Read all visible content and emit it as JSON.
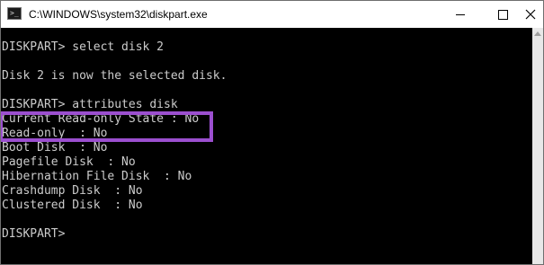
{
  "window": {
    "title": "C:\\WINDOWS\\system32\\diskpart.exe",
    "icon": "console-app-icon"
  },
  "controls": {
    "minimize": "minimize-icon",
    "maximize": "maximize-icon",
    "close": "close-icon"
  },
  "console": {
    "lines": [
      "DISKPART> select disk 2",
      "",
      "Disk 2 is now the selected disk.",
      "",
      "DISKPART> attributes disk",
      "Current Read-only State : No",
      "Read-only  : No",
      "Boot Disk  : No",
      "Pagefile Disk  : No",
      "Hibernation File Disk  : No",
      "Crashdump Disk  : No",
      "Clustered Disk  : No",
      "",
      "DISKPART>"
    ]
  },
  "colors": {
    "highlight": "#9b4fcf",
    "console_bg": "#000000",
    "console_text": "#cccccc"
  }
}
